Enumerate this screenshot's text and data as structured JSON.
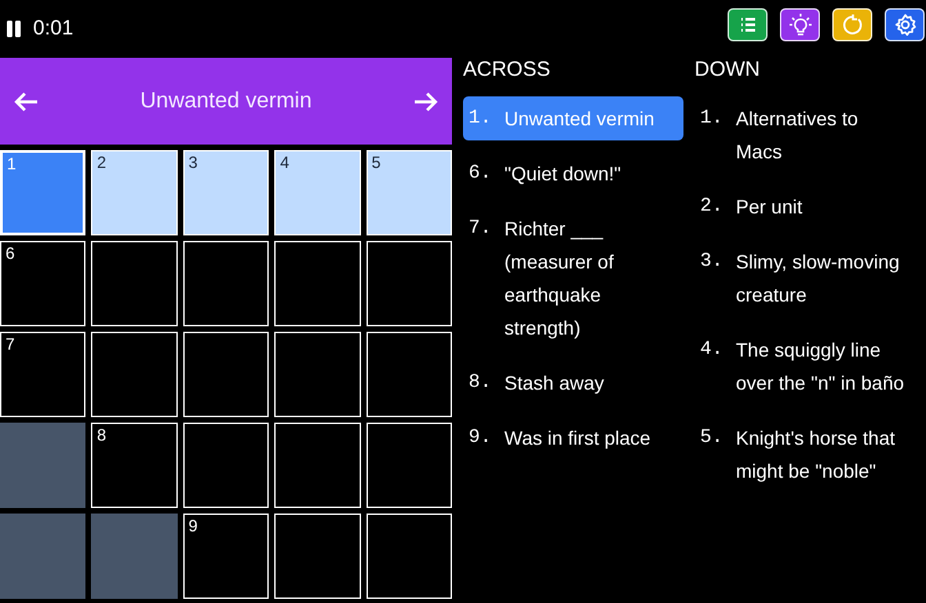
{
  "timer": {
    "paused": false,
    "time": "0:01"
  },
  "toolbar": [
    {
      "kind": "list",
      "color": "#16a34a"
    },
    {
      "kind": "hint",
      "color": "#9333ea"
    },
    {
      "kind": "reset",
      "color": "#eab308"
    },
    {
      "kind": "settings",
      "color": "#2563eb"
    }
  ],
  "clue_bar": {
    "text": "Unwanted vermin"
  },
  "grid": [
    [
      {
        "number": "1",
        "kind": "focus"
      },
      {
        "number": "2",
        "kind": "word"
      },
      {
        "number": "3",
        "kind": "word"
      },
      {
        "number": "4",
        "kind": "word"
      },
      {
        "number": "5",
        "kind": "word"
      }
    ],
    [
      {
        "number": "6",
        "kind": "open"
      },
      {
        "kind": "open"
      },
      {
        "kind": "open"
      },
      {
        "kind": "open"
      },
      {
        "kind": "open"
      }
    ],
    [
      {
        "number": "7",
        "kind": "open"
      },
      {
        "kind": "open"
      },
      {
        "kind": "open"
      },
      {
        "kind": "open"
      },
      {
        "kind": "open"
      }
    ],
    [
      {
        "kind": "block"
      },
      {
        "number": "8",
        "kind": "open"
      },
      {
        "kind": "open"
      },
      {
        "kind": "open"
      },
      {
        "kind": "open"
      }
    ],
    [
      {
        "kind": "block"
      },
      {
        "kind": "block"
      },
      {
        "number": "9",
        "kind": "open"
      },
      {
        "kind": "open"
      },
      {
        "kind": "open"
      }
    ]
  ],
  "across": {
    "title": "ACROSS",
    "clues": [
      {
        "number": "1.",
        "text": "Unwanted vermin",
        "selected": true
      },
      {
        "number": "6.",
        "text": "\"Quiet down!\"",
        "selected": false
      },
      {
        "number": "7.",
        "text": "Richter ___ (measurer of earthquake strength)",
        "selected": false
      },
      {
        "number": "8.",
        "text": "Stash away",
        "selected": false
      },
      {
        "number": "9.",
        "text": "Was in first place",
        "selected": false
      }
    ]
  },
  "down": {
    "title": "DOWN",
    "clues": [
      {
        "number": "1.",
        "text": "Alternatives to Macs",
        "selected": false
      },
      {
        "number": "2.",
        "text": "Per unit",
        "selected": false
      },
      {
        "number": "3.",
        "text": "Slimy, slow-moving creature",
        "selected": false
      },
      {
        "number": "4.",
        "text": "The squiggly line over the \"n\" in baño",
        "selected": false
      },
      {
        "number": "5.",
        "text": "Knight's horse that might be \"noble\"",
        "selected": false
      }
    ]
  }
}
